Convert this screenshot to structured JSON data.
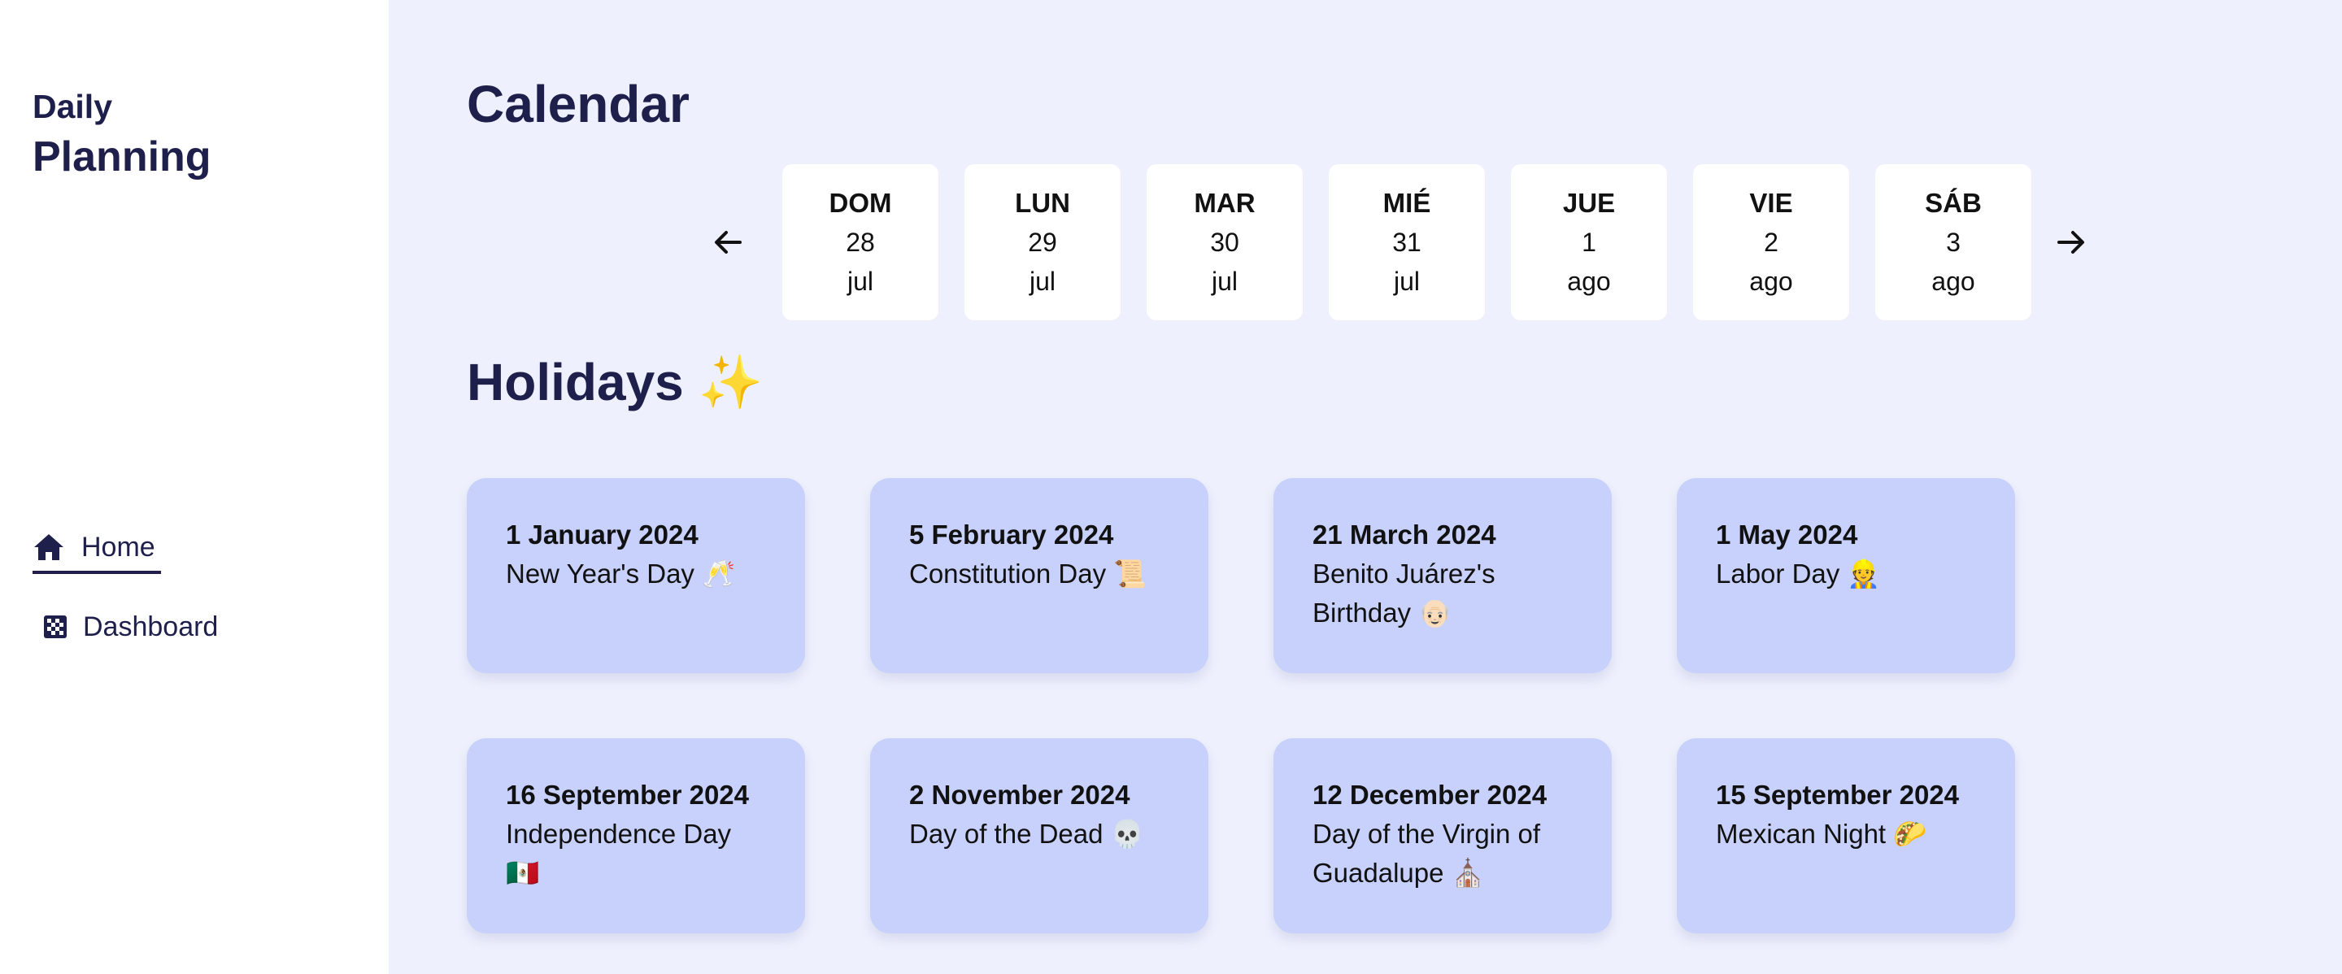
{
  "sidebar": {
    "brand_line1": "Daily",
    "brand_line2": "Planning",
    "nav": [
      {
        "label": "Home",
        "icon": "home-icon",
        "active": true
      },
      {
        "label": "Dashboard",
        "icon": "checkerboard-icon",
        "active": false
      }
    ]
  },
  "calendar": {
    "title": "Calendar",
    "prev_icon": "arrow-left-icon",
    "next_icon": "arrow-right-icon",
    "days": [
      {
        "name": "DOM",
        "num": "28",
        "month": "jul"
      },
      {
        "name": "LUN",
        "num": "29",
        "month": "jul"
      },
      {
        "name": "MAR",
        "num": "30",
        "month": "jul"
      },
      {
        "name": "MIÉ",
        "num": "31",
        "month": "jul"
      },
      {
        "name": "JUE",
        "num": "1",
        "month": "ago"
      },
      {
        "name": "VIE",
        "num": "2",
        "month": "ago"
      },
      {
        "name": "SÁB",
        "num": "3",
        "month": "ago"
      }
    ]
  },
  "holidays": {
    "title": "Holidays ✨",
    "items": [
      {
        "date": "1 January 2024",
        "name": "New Year's Day 🥂"
      },
      {
        "date": "5 February 2024",
        "name": "Constitution Day 📜"
      },
      {
        "date": "21 March 2024",
        "name": "Benito Juárez's Birthday 👴🏻"
      },
      {
        "date": "1 May 2024",
        "name": "Labor Day 👷"
      },
      {
        "date": "16 September 2024",
        "name": "Independence Day 🇲🇽"
      },
      {
        "date": "2 November 2024",
        "name": "Day of the Dead 💀"
      },
      {
        "date": "12 December 2024",
        "name": "Day of the Virgin of Guadalupe ⛪"
      },
      {
        "date": "15 September 2024",
        "name": "Mexican Night 🌮"
      }
    ]
  },
  "colors": {
    "sidebar_bg": "#ffffff",
    "main_bg": "#eef0fd",
    "card_bg": "#c8d1fb",
    "text_dark": "#1e1f4b"
  }
}
